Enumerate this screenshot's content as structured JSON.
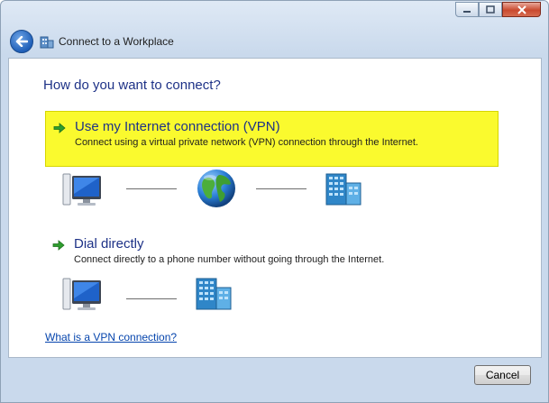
{
  "window": {
    "title": "Connect to a Workplace",
    "caption_buttons": [
      "minimize-icon",
      "maximize-icon",
      "close-icon"
    ]
  },
  "main": {
    "question": "How do you want to connect?",
    "options": [
      {
        "title": "Use my Internet connection (VPN)",
        "description": "Connect using a virtual private network (VPN) connection through the Internet.",
        "highlighted": true,
        "highlight_color": "#fafa2e",
        "diagram": [
          "computer-icon",
          "globe-icon",
          "building-icon"
        ]
      },
      {
        "title": "Dial directly",
        "description": "Connect directly to a phone number without going through the Internet.",
        "highlighted": false,
        "diagram": [
          "computer-icon",
          "building-icon"
        ]
      }
    ],
    "help_link": "What is a VPN connection?"
  },
  "footer": {
    "cancel_label": "Cancel"
  },
  "colors": {
    "heading": "#1e3287",
    "link": "#0645ad",
    "arrow": "#2e9e2e"
  }
}
